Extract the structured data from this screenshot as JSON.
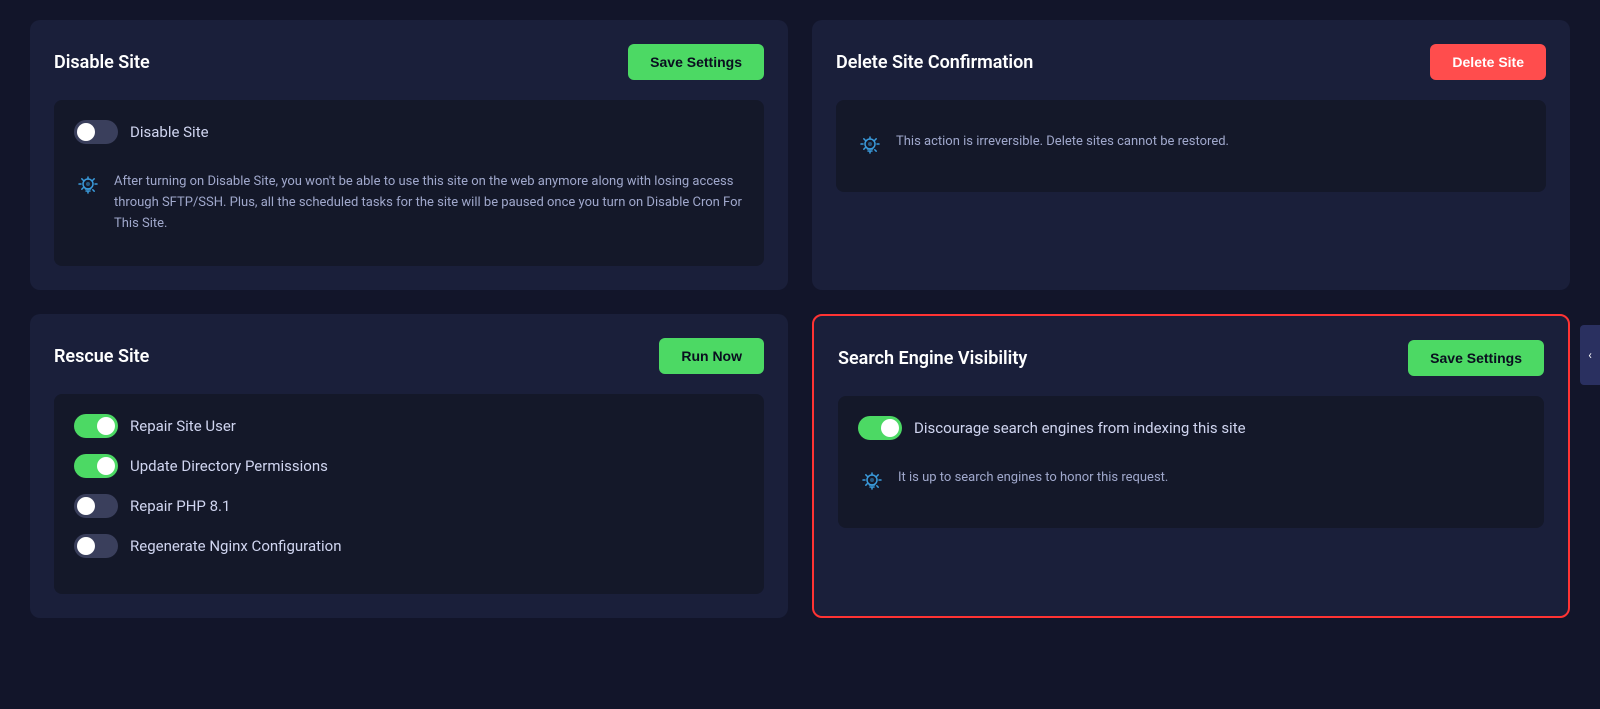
{
  "cards": {
    "disable_site": {
      "title": "Disable Site",
      "save_btn": "Save Settings",
      "toggle_label": "Disable Site",
      "toggle_state": "off",
      "info_text": "After turning on Disable Site, you won't be able to use this site on the web anymore along with losing access through SFTP/SSH. Plus, all the scheduled tasks for the site will be paused once you turn on Disable Cron For This Site."
    },
    "delete_site": {
      "title": "Delete Site Confirmation",
      "delete_btn": "Delete Site",
      "info_text": "This action is irreversible. Delete sites cannot be restored."
    },
    "rescue_site": {
      "title": "Rescue Site",
      "run_btn": "Run Now",
      "toggles": [
        {
          "label": "Repair Site User",
          "state": "on"
        },
        {
          "label": "Update Directory Permissions",
          "state": "on"
        },
        {
          "label": "Repair PHP 8.1",
          "state": "off"
        },
        {
          "label": "Regenerate Nginx Configuration",
          "state": "off"
        }
      ]
    },
    "search_engine": {
      "title": "Search Engine Visibility",
      "save_btn": "Save Settings",
      "toggle_label": "Discourage search engines from indexing this site",
      "toggle_state": "on",
      "info_text": "It is up to search engines to honor this request."
    }
  },
  "sidebar": {
    "chevron": "‹"
  }
}
